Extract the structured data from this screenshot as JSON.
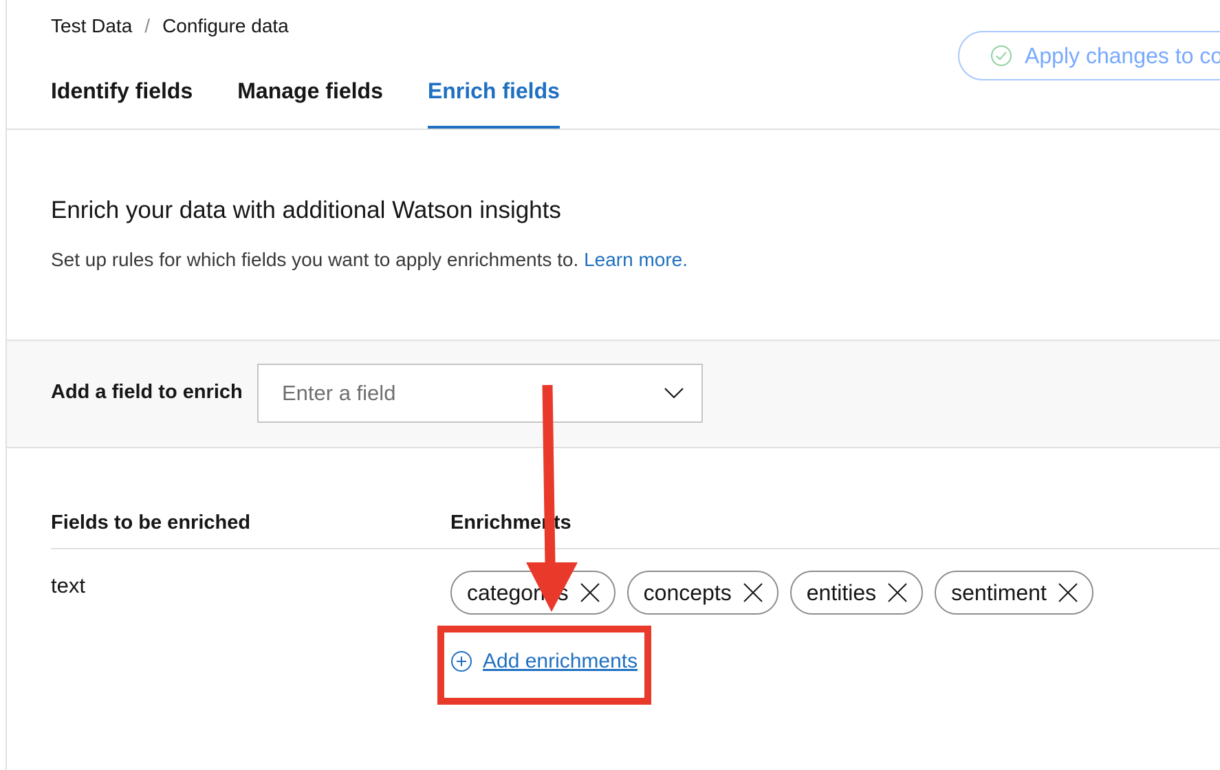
{
  "breadcrumb": {
    "root": "Test Data",
    "separator": "/",
    "current": "Configure data"
  },
  "apply_button": {
    "label": "Apply changes to co",
    "icon": "check-circle-icon"
  },
  "tabs": [
    {
      "label": "Identify fields",
      "active": false
    },
    {
      "label": "Manage fields",
      "active": false
    },
    {
      "label": "Enrich fields",
      "active": true
    }
  ],
  "section": {
    "heading": "Enrich your data with additional Watson insights",
    "description": "Set up rules for which fields you want to apply enrichments to.",
    "learn_more": "Learn more."
  },
  "add_field": {
    "label": "Add a field to enrich",
    "placeholder": "Enter a field",
    "icon": "chevron-down-icon"
  },
  "table": {
    "col_fields": "Fields to be enriched",
    "col_enrichments": "Enrichments",
    "rows": [
      {
        "field": "text",
        "enrichments": [
          "categories",
          "concepts",
          "entities",
          "sentiment"
        ],
        "add_label": "Add enrichments"
      }
    ]
  },
  "annotation": {
    "color": "#e8392a"
  },
  "colors": {
    "accent": "#1f70c1",
    "apply_outline": "#a6c8ff"
  }
}
